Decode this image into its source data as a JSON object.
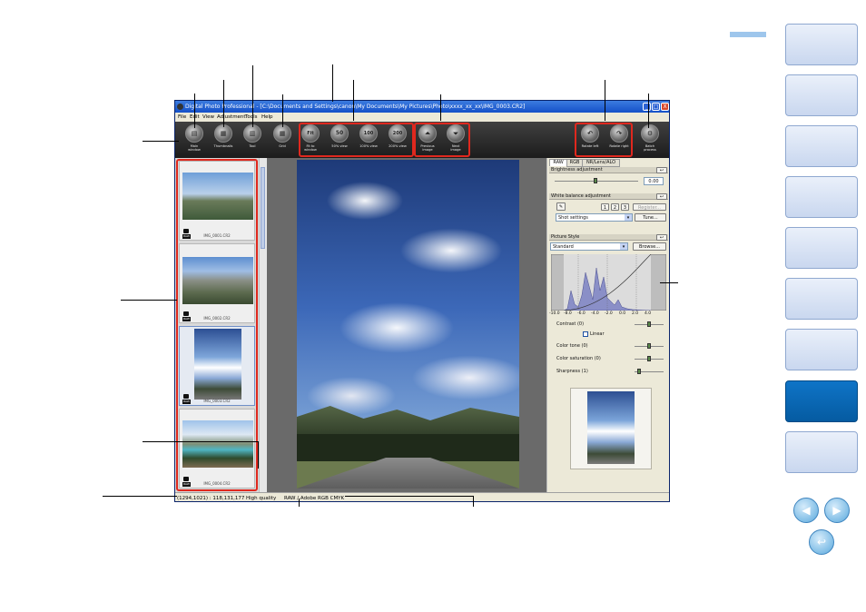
{
  "window": {
    "title": "Digital Photo Professional - [C:\\Documents and Settings\\canon\\My Documents\\My Pictures\\Photo\\xxxx_xx_xx\\IMG_0003.CR2]",
    "controls": [
      "_",
      "□",
      "X"
    ]
  },
  "menu": [
    "File",
    "Edit",
    "View",
    "Adjustment",
    "Tools",
    "Help"
  ],
  "toolbar": {
    "main_window": {
      "label1": "Main",
      "label2": "window"
    },
    "thumbnails": {
      "label1": "Thumbnails",
      "label2": ""
    },
    "tool": {
      "label1": "Tool",
      "label2": ""
    },
    "grid": {
      "label1": "Grid",
      "label2": ""
    },
    "fit_to_window": {
      "label1": "Fit to",
      "label2": "window",
      "glyph": "Fit"
    },
    "view_50": {
      "label1": "50% view",
      "label2": "",
      "glyph": "50"
    },
    "view_100": {
      "label1": "100% view",
      "label2": "",
      "glyph": "100"
    },
    "view_200": {
      "label1": "200% view",
      "label2": "",
      "glyph": "200"
    },
    "previous_image": {
      "label1": "Previous",
      "label2": "image"
    },
    "next_image": {
      "label1": "Next",
      "label2": "image"
    },
    "rotate_left": {
      "label1": "Rotate left",
      "label2": ""
    },
    "rotate_right": {
      "label1": "Rotate right",
      "label2": ""
    },
    "batch_process": {
      "label1": "Batch",
      "label2": "process"
    }
  },
  "thumbnails": [
    {
      "caption": "IMG_0001.CR2",
      "tag": "RAW"
    },
    {
      "caption": "IMG_0002.CR2",
      "tag": "RAW"
    },
    {
      "caption": "IMG_0003.CR2",
      "tag": "RAW"
    },
    {
      "caption": "IMG_0004.CR2",
      "tag": "RAW"
    }
  ],
  "palette": {
    "tabs": [
      "RAW",
      "RGB",
      "NR/Lens/ALO"
    ],
    "brightness": {
      "title": "Brightness adjustment",
      "value": "0.00"
    },
    "white_balance": {
      "title": "White balance adjustment",
      "presets": [
        "1",
        "2",
        "3"
      ],
      "register": "Register...",
      "selected": "Shot settings",
      "tune": "Tune..."
    },
    "picture_style": {
      "title": "Picture Style",
      "selected": "Standard",
      "browse": "Browse...",
      "axis_ticks": [
        "-10.0",
        "-8.0",
        "-6.0",
        "-4.0",
        "-2.0",
        "0.0",
        "2.0",
        "4.0"
      ],
      "contrast": "Contrast (0)",
      "linear": "Linear",
      "color_tone": "Color tone (0)",
      "color_saturation": "Color saturation (0)",
      "sharpness": "Sharpness (1)"
    }
  },
  "status": {
    "coords": "(1294,1021) : 118,131,177",
    "quality": "High quality",
    "mode": "RAW / Adobe RGB  CMYK"
  }
}
